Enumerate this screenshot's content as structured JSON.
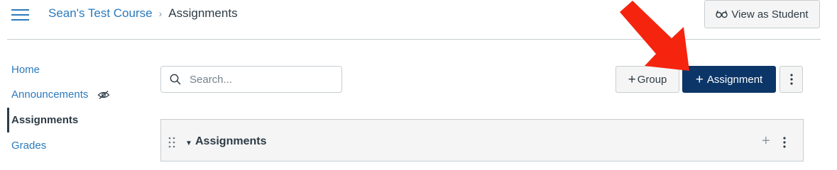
{
  "header": {
    "breadcrumb": {
      "course": "Sean's Test Course",
      "separator": "›",
      "current": "Assignments"
    },
    "view_as_student": "View as Student",
    "icons": {
      "menu": "hamburger-icon",
      "glasses": "glasses-icon"
    }
  },
  "nav": {
    "items": [
      {
        "label": "Home"
      },
      {
        "label": "Announcements"
      },
      {
        "label": "Assignments"
      },
      {
        "label": "Grades"
      }
    ],
    "active_index": 2
  },
  "toolbar": {
    "search_placeholder": "Search...",
    "group_label": "Group",
    "assignment_label": "Assignment",
    "plus_glyph": "+",
    "icons": {
      "search": "search-icon",
      "more": "vertical-ellipsis-icon"
    }
  },
  "assignment_group": {
    "title": "Assignments",
    "add_glyph": "+"
  },
  "colors": {
    "link": "#2b7abc",
    "primary_button": "#0b3667",
    "annotation_arrow": "#f5240f"
  }
}
